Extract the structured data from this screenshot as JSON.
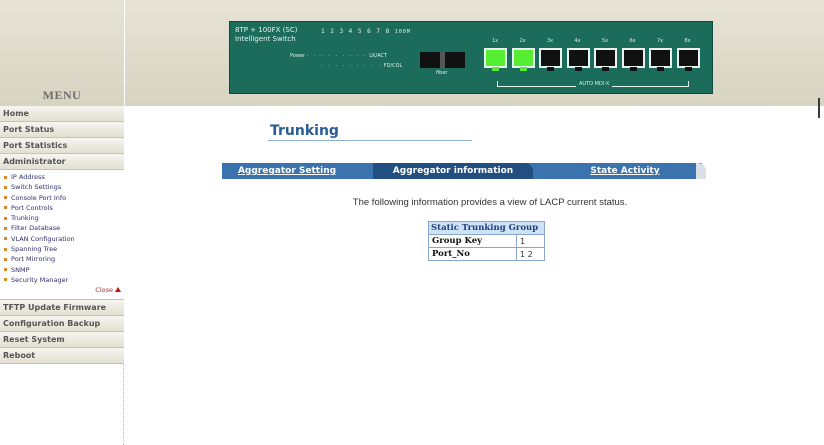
{
  "menu": {
    "title": "MENU",
    "items_top": [
      "Home",
      "Port Status",
      "Port Statistics",
      "Administrator"
    ],
    "sub_items": [
      "IP Address",
      "Switch Settings",
      "Console Port Info",
      "Port Controls",
      "Trunking",
      "Filter Database",
      "VLAN Configuration",
      "Spanning Tree",
      "Port Mirroring",
      "SNMP",
      "Security Manager"
    ],
    "close_label": "Close",
    "items_bottom": [
      "TFTP Update Firmware",
      "Configuration Backup",
      "Reset System",
      "Reboot"
    ]
  },
  "device": {
    "name_line1": "8TP + 100FX (SC)",
    "name_line2": "Intelligent Switch",
    "led_numbers": "1 2 3 4 5 6 7 8",
    "led_100m": "100M",
    "power_label": "Power",
    "lk_act": "LK/ACT",
    "fd_col": "FD/COL",
    "fiber_label": "fiber",
    "port_labels": [
      "1x",
      "2x",
      "3x",
      "4x",
      "5x",
      "6x",
      "7x",
      "8x"
    ],
    "port_active": [
      true,
      true,
      false,
      false,
      false,
      false,
      false,
      false
    ],
    "auto_mdi": "AUTO MDI-X"
  },
  "page": {
    "title": "Trunking",
    "tabs": {
      "aggregator_setting": "Aggregator Setting",
      "aggregator_information": "Aggregator information",
      "state_activity": "State Activity"
    },
    "description": "The following information provides a view of LACP current status.",
    "table": {
      "header": "Static Trunking Group",
      "rows": [
        {
          "label": "Group Key",
          "value": "1"
        },
        {
          "label": "Port_No",
          "value": "1 2"
        }
      ]
    }
  },
  "colors": {
    "tab_bar": "#3a73ad",
    "tab_current": "#214f82",
    "device_panel": "#1b6c5b",
    "port_active": "#55ee33",
    "title_blue": "#2a5d95"
  }
}
